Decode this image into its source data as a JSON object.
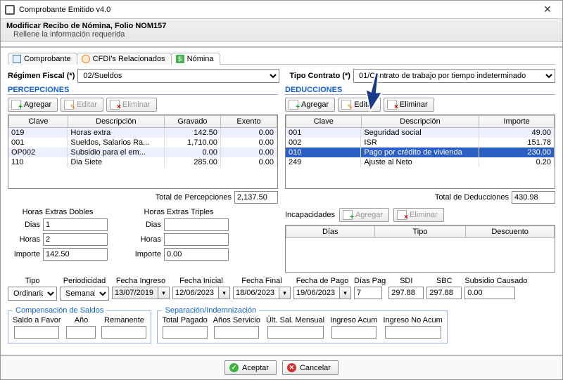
{
  "window": {
    "title": "Comprobante Emitido v4.0"
  },
  "header": {
    "title": "Modificar Recibo de Nómina, Folio NOM157",
    "sub": "Rellene la información requerida"
  },
  "tabs": {
    "t1": "Comprobante",
    "t2": "CFDI's Relacionados",
    "t3": "Nómina",
    "nom_icon": "$"
  },
  "top": {
    "regimen_lbl": "Régimen Fiscal (*)",
    "regimen_val": "02/Sueldos",
    "contrato_lbl": "Tipo Contrato (*)",
    "contrato_val": "01/Contrato de trabajo por tiempo indeterminado"
  },
  "perc": {
    "title": "PERCEPCIONES",
    "add": "Agregar",
    "edit": "Editar",
    "del": "Eliminar",
    "cols": {
      "c1": "Clave",
      "c2": "Descripción",
      "c3": "Gravado",
      "c4": "Exento"
    },
    "rows": [
      {
        "c": "019",
        "d": "Horas extra",
        "g": "142.50",
        "e": "0.00"
      },
      {
        "c": "001",
        "d": "Sueldos, Salarios  Ra...",
        "g": "1,710.00",
        "e": "0.00"
      },
      {
        "c": "OP002",
        "d": "Subsidio para el em...",
        "g": "0.00",
        "e": "0.00"
      },
      {
        "c": "110",
        "d": "Dia Siete",
        "g": "285.00",
        "e": "0.00"
      }
    ],
    "total_lbl": "Total de Percepciones",
    "total": "2,137.50"
  },
  "ded": {
    "title": "DEDUCCIONES",
    "add": "Agregar",
    "edit": "Editar",
    "del": "Eliminar",
    "cols": {
      "c1": "Clave",
      "c2": "Descripción",
      "c3": "Importe"
    },
    "rows": [
      {
        "c": "001",
        "d": "Seguridad social",
        "i": "49.00"
      },
      {
        "c": "002",
        "d": "ISR",
        "i": "151.78"
      },
      {
        "c": "010",
        "d": "Pago por crédito de vivienda",
        "i": "230.00",
        "sel": true
      },
      {
        "c": "249",
        "d": "Ajuste al Neto",
        "i": "0.20"
      }
    ],
    "total_lbl": "Total de Deducciones",
    "total": "430.98"
  },
  "horas": {
    "dobles_lbl": "Horas Extras Dobles",
    "triples_lbl": "Horas Extras Triples",
    "dias_lbl": "Dias",
    "horas_lbl": "Horas",
    "importe_lbl": "Importe",
    "d_dias": "1",
    "d_horas": "2",
    "d_imp": "142.50",
    "t_dias": "",
    "t_horas": "",
    "t_imp": "0.00"
  },
  "incap": {
    "lbl": "Incapacidades",
    "add": "Agregar",
    "del": "Eliminar",
    "c1": "Días",
    "c2": "Tipo",
    "c3": "Descuento"
  },
  "form": {
    "tipo_lbl": "Tipo",
    "tipo_val": "Ordinaria",
    "period_lbl": "Periodicidad",
    "period_val": "Semanal",
    "fing_lbl": "Fecha Ingreso",
    "fing": "13/07/2019",
    "fini_lbl": "Fecha Inicial",
    "fini": "12/06/2023",
    "ffin_lbl": "Fecha Final",
    "ffin": "18/06/2023",
    "fpag_lbl": "Fecha de Pago",
    "fpag": "19/06/2023",
    "dpag_lbl": "Días Pag",
    "dpag": "7",
    "sdi_lbl": "SDI",
    "sdi": "297.88",
    "sbc_lbl": "SBC",
    "sbc": "297.88",
    "sub_lbl": "Subsidio Causado",
    "sub": "0.00"
  },
  "comp": {
    "legend": "Compensación de Saldos",
    "saldo": "Saldo a Favor",
    "ano": "Año",
    "rem": "Remanente"
  },
  "sep": {
    "legend": "Separación/Indemnización",
    "tp": "Total Pagado",
    "as": "Años Servicio",
    "usm": "Últ. Sal. Mensual",
    "ia": "Ingreso Acum",
    "ina": "Ingreso No Acum"
  },
  "footer": {
    "ok": "Aceptar",
    "cancel": "Cancelar"
  }
}
